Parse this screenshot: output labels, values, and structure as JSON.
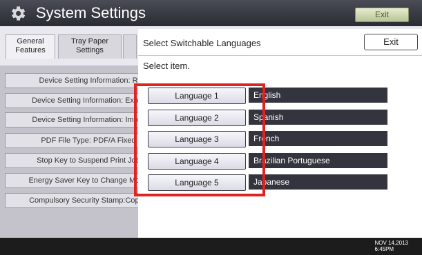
{
  "header": {
    "title": "System Settings",
    "exit_label": "Exit",
    "icon": "gear-icon"
  },
  "tabs": [
    {
      "line1": "General",
      "line2": "Features"
    },
    {
      "line1": "Tray Paper",
      "line2": "Settings"
    }
  ],
  "left_list": {
    "items": [
      "Device Setting Information: R",
      "Device Setting Information: Expor",
      "Device Setting Information: Impor",
      "PDF File Type: PDF/A Fixed",
      "Stop Key to Suspend Print Job",
      "Energy Saver Key to Change Mode",
      "Compulsory Security Stamp:Copier"
    ]
  },
  "dialog": {
    "title": "Select Switchable Languages",
    "exit_label": "Exit",
    "subtitle": "Select item.",
    "languages": [
      {
        "button": "Language 1",
        "value": "English"
      },
      {
        "button": "Language 2",
        "value": "Spanish"
      },
      {
        "button": "Language 3",
        "value": "French"
      },
      {
        "button": "Language 4",
        "value": "Brazilian Portuguese"
      },
      {
        "button": "Language 5",
        "value": "Japanese"
      }
    ]
  },
  "footer": {
    "date": "NOV 14,2013",
    "time": "6:45PM"
  },
  "colors": {
    "highlight": "#e02222",
    "value_bg": "#34343e",
    "header_bg": "#2a2c33"
  }
}
